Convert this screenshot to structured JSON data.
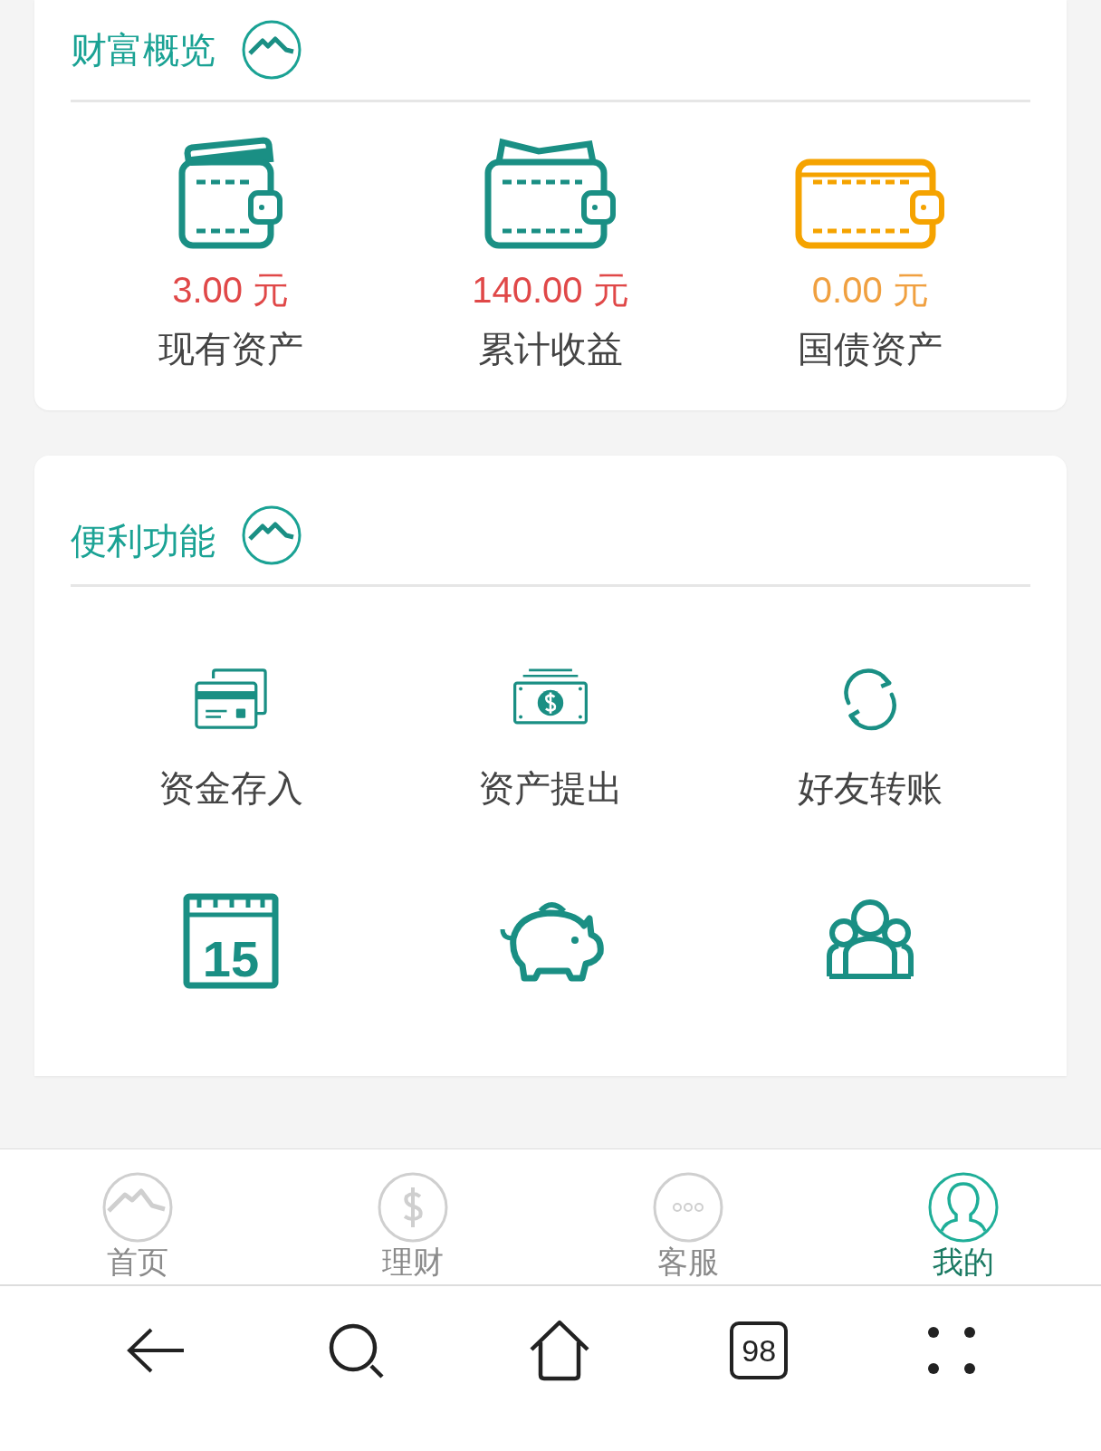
{
  "wealth_overview": {
    "title": "财富概览",
    "items": [
      {
        "kind": "card_wallet",
        "amount": "3.00 元",
        "label": "现有资产",
        "color": "#e04848"
      },
      {
        "kind": "cash_wallet",
        "amount": "140.00 元",
        "label": "累计收益",
        "color": "#e04848"
      },
      {
        "kind": "orange_wallet",
        "amount": "0.00 元",
        "label": "国债资产",
        "color": "#f0a040"
      }
    ]
  },
  "convenience": {
    "title": "便利功能",
    "items": [
      {
        "kind": "cards",
        "label": "资金存入"
      },
      {
        "kind": "banknote",
        "label": "资产提出"
      },
      {
        "kind": "refresh",
        "label": "好友转账"
      },
      {
        "kind": "calendar",
        "day": "15"
      },
      {
        "kind": "piggy"
      },
      {
        "kind": "team"
      }
    ]
  },
  "tab_bar": [
    {
      "kind": "mountain",
      "label": "首页",
      "selected": false
    },
    {
      "kind": "dollar",
      "label": "理财",
      "selected": false
    },
    {
      "kind": "dots",
      "label": "客服",
      "selected": false
    },
    {
      "kind": "person",
      "label": "我的",
      "selected": true
    }
  ],
  "browser_bar": [
    {
      "kind": "back"
    },
    {
      "kind": "search"
    },
    {
      "kind": "home"
    },
    {
      "kind": "tabs",
      "count": "98"
    },
    {
      "kind": "menu"
    }
  ]
}
